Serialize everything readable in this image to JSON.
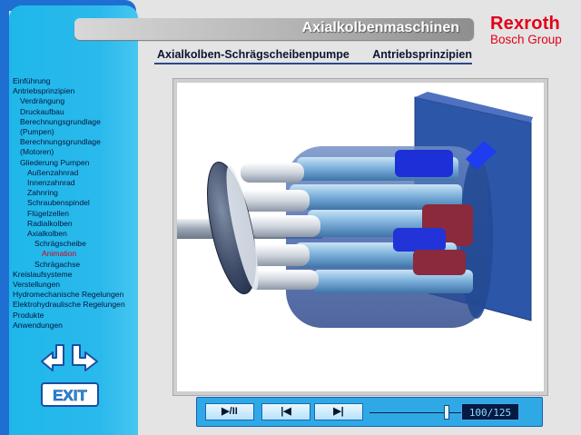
{
  "header": {
    "title": "Axialkolbenmaschinen",
    "subtitle_left": "Axialkolben-Schrägscheibenpumpe",
    "subtitle_right": "Antriebsprinzipien"
  },
  "logo": {
    "brand": "Rexroth",
    "group": "Bosch Group"
  },
  "sidebar": {
    "items": [
      {
        "label": "Einführung",
        "level": 0
      },
      {
        "label": "Antriebsprinzipien",
        "level": 0
      },
      {
        "label": "Verdrängung",
        "level": 1
      },
      {
        "label": "Druckaufbau",
        "level": 1
      },
      {
        "label": "Berechnungsgrundlage",
        "level": 1
      },
      {
        "label": "(Pumpen)",
        "level": 1
      },
      {
        "label": "Berechnungsgrundlage",
        "level": 1
      },
      {
        "label": "(Motoren)",
        "level": 1
      },
      {
        "label": "Gliederung Pumpen",
        "level": 1
      },
      {
        "label": "Außenzahnrad",
        "level": 2
      },
      {
        "label": "Innenzahnrad",
        "level": 2
      },
      {
        "label": "Zahnring",
        "level": 2
      },
      {
        "label": "Schraubenspindel",
        "level": 2
      },
      {
        "label": "Flügelzellen",
        "level": 2
      },
      {
        "label": "Radialkolben",
        "level": 2
      },
      {
        "label": "Axialkolben",
        "level": 2
      },
      {
        "label": "Schrägscheibe",
        "level": 3
      },
      {
        "label": "Animation",
        "level": 4,
        "active": true
      },
      {
        "label": "Schrägachse",
        "level": 3
      },
      {
        "label": "Kreislaufsysteme",
        "level": 0
      },
      {
        "label": "Verstellungen",
        "level": 0
      },
      {
        "label": "Hydromechanische Regelungen",
        "level": 0
      },
      {
        "label": "Elektrohydraulische Regelungen",
        "level": 0
      },
      {
        "label": "Produkte",
        "level": 0
      },
      {
        "label": "Anwendungen",
        "level": 0
      }
    ],
    "exit_label": "EXIT",
    "back_icon": "back-arrow-icon",
    "forward_icon": "forward-arrow-icon"
  },
  "player": {
    "play_pause_label": "▶/II",
    "prev_label": "▶|",
    "next_label": "▶|",
    "frame_current": 100,
    "frame_total": 125,
    "frame_readout": "100/125"
  },
  "colors": {
    "sidebar_blue": "#2ab9ec",
    "brand_red": "#e2001a",
    "active_item": "#d6001c",
    "player_blue": "#2ea9e6"
  }
}
